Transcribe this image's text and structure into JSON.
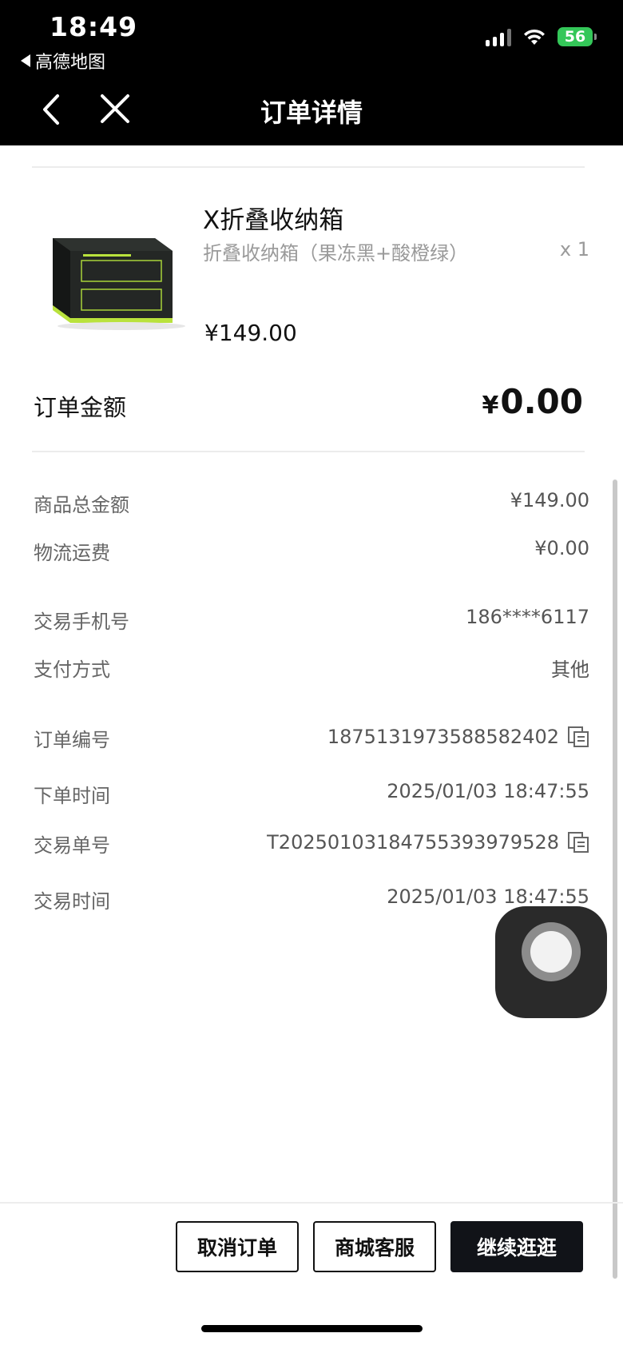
{
  "status": {
    "time": "18:49",
    "back_app": "高德地图",
    "battery": "56"
  },
  "nav": {
    "title": "订单详情"
  },
  "product": {
    "name": "X折叠收纳箱",
    "spec": "折叠收纳箱（果冻黑+酸橙绿）",
    "qty": "x 1",
    "price": "¥149.00",
    "image_icon": "storage-box-image"
  },
  "order_total": {
    "label": "订单金额",
    "currency": "¥",
    "value": "0.00"
  },
  "details": [
    {
      "label": "商品总金额",
      "value": "¥149.00"
    },
    {
      "label": "物流运费",
      "value": "¥0.00"
    },
    {
      "label": "交易手机号",
      "value": "186****6117"
    },
    {
      "label": "支付方式",
      "value": "其他"
    },
    {
      "label": "订单编号",
      "value": "1875131973588582402",
      "copy": true
    },
    {
      "label": "下单时间",
      "value": "2025/01/03 18:47:55"
    },
    {
      "label": "交易单号",
      "value": "T2025010318475539397952​8",
      "copy": true
    },
    {
      "label": "交易时间",
      "value": "2025/01/03 18:47:55"
    }
  ],
  "actions": {
    "cancel": "取消订单",
    "service": "商城客服",
    "continue": "继续逛逛"
  },
  "colors": {
    "topbar": "#000000",
    "dark_button": "#111318",
    "battery": "#34c759"
  }
}
